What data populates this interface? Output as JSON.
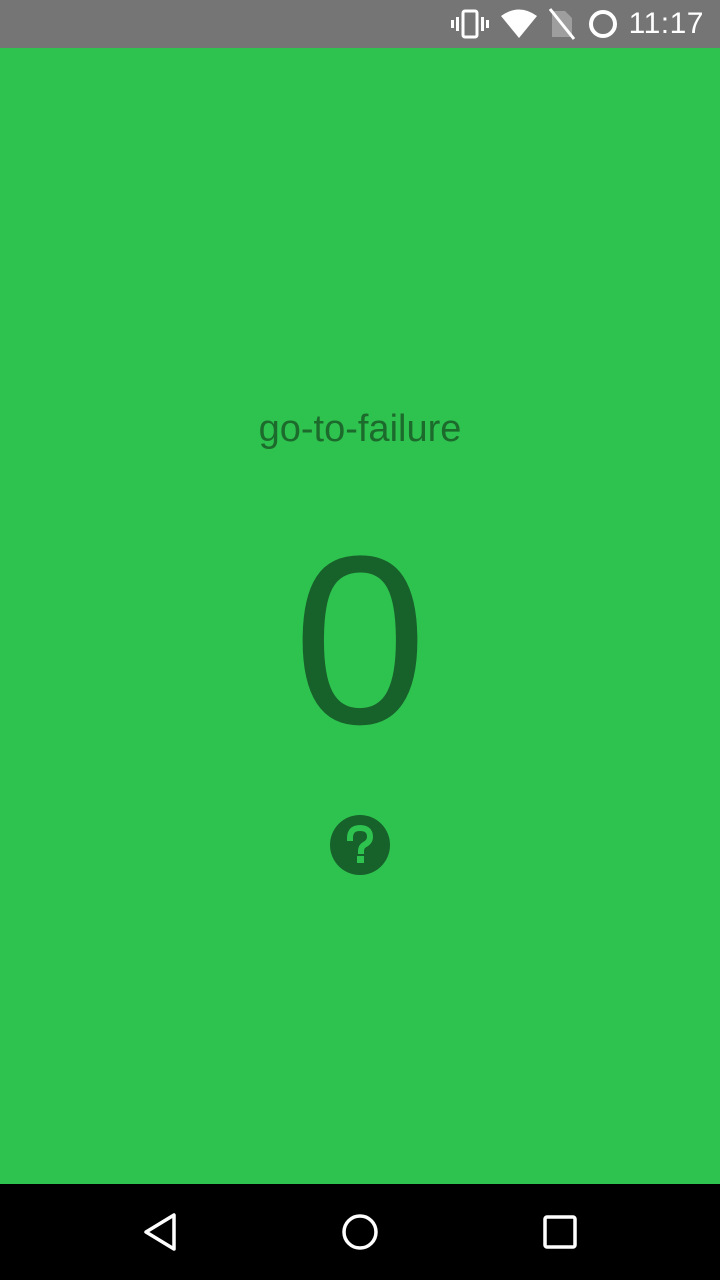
{
  "status_bar": {
    "time": "11:17",
    "icons": [
      "vibrate-icon",
      "wifi-icon",
      "no-sim-icon",
      "sync-icon"
    ]
  },
  "main": {
    "exercise_name": "go-to-failure",
    "count": "0",
    "help_icon": "question-icon"
  },
  "navigation": {
    "buttons": [
      "back-icon",
      "home-icon",
      "recents-icon"
    ]
  },
  "colors": {
    "background": "#2ec24f",
    "accent_dark": "#17612a",
    "status_bar": "#757575",
    "nav_bar": "#000000"
  }
}
